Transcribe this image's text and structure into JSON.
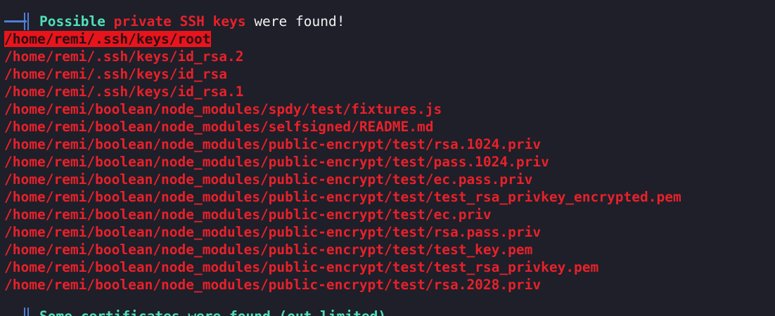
{
  "header": {
    "word1": "Possible",
    "word2": "private",
    "word3": "SSH",
    "word4": "keys",
    "word5": "were found!"
  },
  "paths": [
    "/home/remi/.ssh/keys/root",
    "/home/remi/.ssh/keys/id_rsa.2",
    "/home/remi/.ssh/keys/id_rsa",
    "/home/remi/.ssh/keys/id_rsa.1",
    "/home/remi/boolean/node_modules/spdy/test/fixtures.js",
    "/home/remi/boolean/node_modules/selfsigned/README.md",
    "/home/remi/boolean/node_modules/public-encrypt/test/rsa.1024.priv",
    "/home/remi/boolean/node_modules/public-encrypt/test/pass.1024.priv",
    "/home/remi/boolean/node_modules/public-encrypt/test/ec.pass.priv",
    "/home/remi/boolean/node_modules/public-encrypt/test/test_rsa_privkey_encrypted.pem",
    "/home/remi/boolean/node_modules/public-encrypt/test/ec.priv",
    "/home/remi/boolean/node_modules/public-encrypt/test/rsa.pass.priv",
    "/home/remi/boolean/node_modules/public-encrypt/test/test_key.pem",
    "/home/remi/boolean/node_modules/public-encrypt/test/test_rsa_privkey.pem",
    "/home/remi/boolean/node_modules/public-encrypt/test/rsa.2028.priv"
  ],
  "highlighted_index": 0,
  "next_section": {
    "text": "Some certificates were found (out limited)"
  },
  "colors": {
    "background": "#1e1f29",
    "heading_cyan": "#50e0b8",
    "path_red": "#e8212a",
    "highlight_bg": "#e8141c",
    "icon_blue": "#4f7fd6"
  },
  "icons": {
    "section_marker": "section-marker-icon"
  }
}
